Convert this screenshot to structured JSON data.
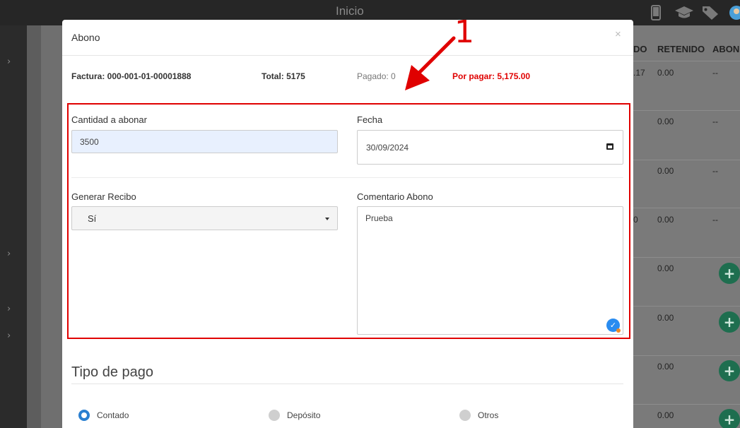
{
  "topbar": {
    "title": "Inicio",
    "icons": [
      "phone-icon",
      "graduation-cap-icon",
      "tags-icon",
      "avatar"
    ]
  },
  "table_bg": {
    "headers": [
      "DO",
      "RETENIDO",
      "ABON"
    ],
    "partial_values": [
      ".17",
      "0"
    ],
    "retenido": [
      "0.00",
      "0.00",
      "0.00",
      "0.00",
      "0.00",
      "0.00",
      "0.00",
      "0.00"
    ],
    "abono": [
      "--",
      "--",
      "--",
      "--"
    ]
  },
  "modal": {
    "title": "Abono",
    "close_label": "×",
    "factura": "Factura: 000-001-01-00001888",
    "total": "Total: 5175",
    "pagado": "Pagado: 0",
    "por_pagar": "Por pagar: 5,175.00",
    "cantidad_label": "Cantidad a abonar",
    "cantidad_value": "3500",
    "fecha_label": "Fecha",
    "fecha_value": "30/09/2024",
    "recibo_label": "Generar Recibo",
    "recibo_value": "Sí",
    "comentario_label": "Comentario Abono",
    "comentario_value": "Prueba",
    "tipo_pago_title": "Tipo de pago",
    "tipo_pago_options": [
      "Contado",
      "Depósito",
      "Otros"
    ],
    "tipo_pago_selected": "Contado"
  },
  "annotation": {
    "number": "1",
    "color": "#e00000"
  }
}
